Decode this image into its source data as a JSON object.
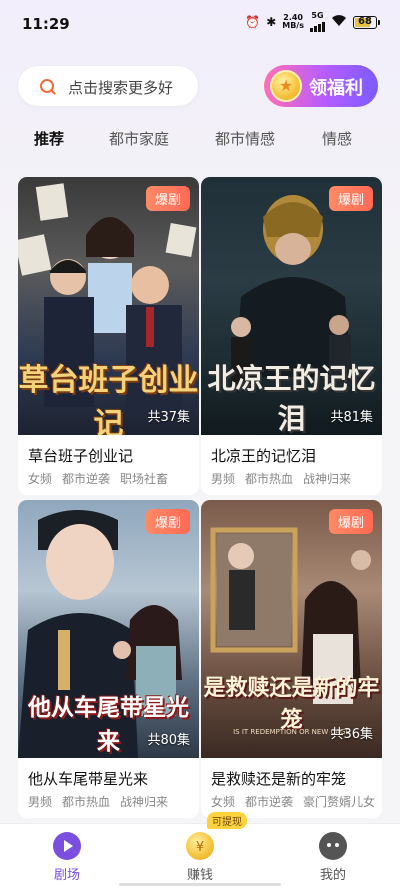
{
  "status": {
    "time": "11:29",
    "speed_value": "2.40",
    "speed_unit": "MB/s",
    "network": "5G",
    "battery": "68",
    "icons": [
      "alarm-icon",
      "bluetooth-icon",
      "signal-icon",
      "wifi-icon",
      "battery-icon"
    ]
  },
  "search": {
    "placeholder": "点击搜索更多好"
  },
  "welfare": {
    "label": "领福利"
  },
  "tabs": [
    "推荐",
    "都市家庭",
    "都市情感",
    "情感"
  ],
  "cards": [
    {
      "tag": "爆剧",
      "poster_title": "草台班子创业记",
      "episodes": "共37集",
      "title": "草台班子创业记",
      "tags": [
        "女频",
        "都市逆袭",
        "职场社畜"
      ]
    },
    {
      "tag": "爆剧",
      "poster_title": "北凉王的记忆泪",
      "episodes": "共81集",
      "title": "北凉王的记忆泪",
      "tags": [
        "男频",
        "都市热血",
        "战神归来"
      ]
    },
    {
      "tag": "爆剧",
      "poster_title": "他从车尾带星光来",
      "episodes": "共80集",
      "title": "他从车尾带星光来",
      "tags": [
        "男频",
        "都市热血",
        "战神归来"
      ]
    },
    {
      "tag": "爆剧",
      "poster_title": "是救赎还是新的牢笼",
      "poster_subtitle": "IS IT REDEMPTION OR NEW CAGE",
      "episodes": "共36集",
      "title": "是救赎还是新的牢笼",
      "tags": [
        "女频",
        "都市逆袭",
        "豪门赘婿儿女"
      ]
    }
  ],
  "nav": [
    {
      "label": "剧场",
      "icon": "theater-play-icon",
      "active": true
    },
    {
      "label": "赚钱",
      "icon": "coin-icon",
      "badge": "可提现"
    },
    {
      "label": "我的",
      "icon": "profile-icon"
    }
  ],
  "colors": {
    "accent": "#7a4fe0",
    "tag": "#ff6a55",
    "search_icon": "#f26b3a"
  }
}
